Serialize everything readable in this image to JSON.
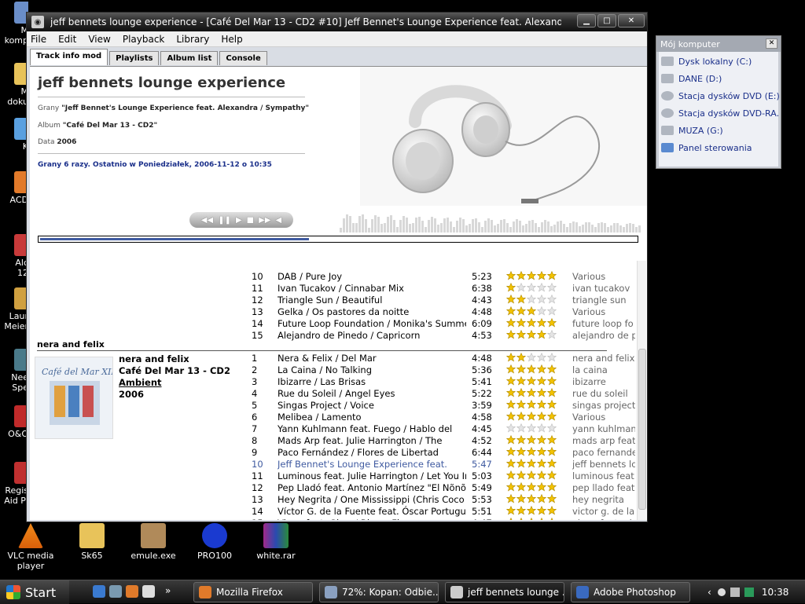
{
  "desktop": {
    "left_edge_labels": [
      {
        "text": "M\nkomp"
      },
      {
        "text": "M\ndoku"
      },
      {
        "text": "K"
      },
      {
        "text": "ACD"
      },
      {
        "text": "Alc\n12"
      },
      {
        "text": "Laur\nMeier"
      },
      {
        "text": "Nee\nSpe"
      },
      {
        "text": "O&O"
      },
      {
        "text": "Regis\nAid Pl"
      }
    ],
    "bottom_icons": [
      "VLC media player",
      "Sk65",
      "emule.exe",
      "PRO100",
      "white.rar"
    ]
  },
  "window": {
    "title": "jeff bennets lounge experience - [Café Del Mar 13 - CD2 #10] Jeff Bennet's Lounge Experience feat. Alexandra / Symp...",
    "menu": [
      "File",
      "Edit",
      "View",
      "Playback",
      "Library",
      "Help"
    ],
    "tabs": [
      "Track info mod",
      "Playlists",
      "Album list",
      "Console"
    ],
    "info": {
      "artist": "jeff bennets lounge experience",
      "playing_label": "Grany",
      "playing_value": "\"Jeff Bennet's Lounge Experience feat. Alexandra / Sympathy\"",
      "album_label": "Album",
      "album_value": "\"Café Del Mar 13 - CD2\"",
      "date_label": "Data",
      "date_value": "2006",
      "played_stats": "Grany 6 razy. Ostatnio w Poniedziałek, 2006-11-12 o 10:35"
    },
    "playback_progress": 0.45,
    "transport": [
      "◀◀",
      "❚❚",
      "▶",
      "■",
      "▶▶",
      "◀"
    ]
  },
  "playlist": {
    "group_top": [
      {
        "num": "10",
        "name": "DAB / Pure Joy",
        "len": "5:23",
        "rating": 5,
        "album": "Various"
      },
      {
        "num": "11",
        "name": "Ivan Tucakov / Cinnabar Mix",
        "len": "6:38",
        "rating": 1,
        "album": "ivan tucakov"
      },
      {
        "num": "12",
        "name": "Triangle Sun / Beautiful",
        "len": "4:43",
        "rating": 2,
        "album": "triangle sun"
      },
      {
        "num": "13",
        "name": "Gelka / Os pastores da noitte",
        "len": "4:48",
        "rating": 3,
        "album": "Various"
      },
      {
        "num": "14",
        "name": "Future Loop Foundation / Monika's Summer",
        "len": "6:09",
        "rating": 5,
        "album": "future loop fo"
      },
      {
        "num": "15",
        "name": "Alejandro de Pinedo / Capricorn",
        "len": "4:53",
        "rating": 4,
        "album": "alejandro de p"
      }
    ],
    "group_header": "nera and felix",
    "group_meta": {
      "artist": "nera and felix",
      "album": "Café Del Mar 13 - CD2",
      "genre": "Ambient",
      "year": "2006"
    },
    "group_rows": [
      {
        "num": "1",
        "name": "Nera & Felix / Del Mar",
        "len": "4:48",
        "rating": 2,
        "album": "nera and felix"
      },
      {
        "num": "2",
        "name": "La Caina / No Talking",
        "len": "5:36",
        "rating": 5,
        "album": "la caina"
      },
      {
        "num": "3",
        "name": "Ibizarre / Las Brisas",
        "len": "5:41",
        "rating": 5,
        "album": "ibizarre"
      },
      {
        "num": "4",
        "name": "Rue du Soleil / Angel Eyes",
        "len": "5:22",
        "rating": 5,
        "album": "rue du soleil"
      },
      {
        "num": "5",
        "name": "Singas Project / Voice",
        "len": "3:59",
        "rating": 5,
        "album": "singas project"
      },
      {
        "num": "6",
        "name": "Melibea / Lamento",
        "len": "4:58",
        "rating": 5,
        "album": "Various"
      },
      {
        "num": "7",
        "name": "Yann Kuhlmann feat. Fuego  / Hablo del",
        "len": "4:45",
        "rating": 0,
        "album": "yann kuhlman"
      },
      {
        "num": "8",
        "name": "Mads Arp feat. Julie Harrington / The",
        "len": "4:52",
        "rating": 5,
        "album": "mads arp feat"
      },
      {
        "num": "9",
        "name": "Paco Fernández / Flores de Libertad",
        "len": "6:44",
        "rating": 5,
        "album": "paco fernandez"
      },
      {
        "num": "10",
        "name": "Jeff Bennet's Lounge Experience feat.",
        "len": "5:47",
        "rating": 5,
        "album": "jeff bennets lo",
        "selected": true
      },
      {
        "num": "11",
        "name": "Luminous feat. Julie Harrington / Let You In",
        "len": "5:03",
        "rating": 5,
        "album": "luminous feat"
      },
      {
        "num": "12",
        "name": "Pep Lladó feat. Antonio Martínez \"El Nõnõ\" /",
        "len": "5:49",
        "rating": 5,
        "album": "pep llado feat"
      },
      {
        "num": "13",
        "name": "Hey Negrita / One Mississippi (Chris Coco",
        "len": "5:53",
        "rating": 5,
        "album": "hey negrita"
      },
      {
        "num": "14",
        "name": "Víctor G. de la Fuente feat. Óscar Portugués",
        "len": "5:51",
        "rating": 5,
        "album": "victor g. de la"
      },
      {
        "num": "15",
        "name": "Viggo feat. Glow / Rivers Flow",
        "len": "4:47",
        "rating": 5,
        "album": "viggo feat. glo"
      }
    ],
    "album_art_text": "Café del Mar XIII"
  },
  "moj_komputer": {
    "title": "Mój komputer",
    "items": [
      "Dysk lokalny (C:)",
      "DANE (D:)",
      "Stacja dysków DVD (E:)",
      "Stacja dysków DVD-RA...",
      "MUZA (G:)",
      "Panel sterowania"
    ]
  },
  "taskbar": {
    "start": "Start",
    "buttons": [
      "Mozilla Firefox",
      "72%: Kopan: Odbie...",
      "jeff bennets lounge ...",
      "Adobe Photoshop"
    ],
    "clock": "10:38",
    "chevron": "»"
  },
  "colors": {
    "accent": "#3f5aa0",
    "star": "#f2c200",
    "link": "#1a2f8a"
  }
}
